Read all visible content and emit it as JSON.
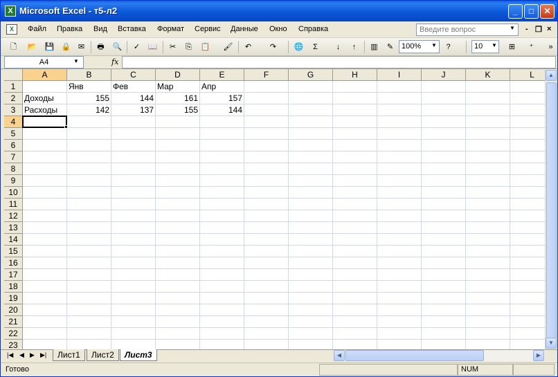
{
  "window": {
    "title": "Microsoft Excel - т5-л2",
    "app_icon": "X",
    "min": "_",
    "max": "□",
    "close": "✕"
  },
  "menu": {
    "doc_icon": "X",
    "items": [
      "Файл",
      "Правка",
      "Вид",
      "Вставка",
      "Формат",
      "Сервис",
      "Данные",
      "Окно",
      "Справка"
    ],
    "help_placeholder": "Введите вопрос",
    "mdi_min": "-",
    "mdi_restore": "❐",
    "mdi_close": "×"
  },
  "toolbar": {
    "zoom": "100%",
    "font_size": "10"
  },
  "formula": {
    "name_box": "A4",
    "fx": "fx",
    "value": ""
  },
  "grid": {
    "columns": [
      "A",
      "B",
      "C",
      "D",
      "E",
      "F",
      "G",
      "H",
      "I",
      "J",
      "K",
      "L"
    ],
    "rows": [
      "1",
      "2",
      "3",
      "4",
      "5",
      "6",
      "7",
      "8",
      "9",
      "10",
      "11",
      "12",
      "13",
      "14",
      "15",
      "16",
      "17",
      "18",
      "19",
      "20",
      "21",
      "22",
      "23"
    ],
    "cells": {
      "B1": "Янв",
      "C1": "Фев",
      "D1": "Мар",
      "E1": "Апр",
      "A2": "Доходы",
      "B2": "155",
      "C2": "144",
      "D2": "161",
      "E2": "157",
      "A3": "Расходы",
      "B3": "142",
      "C3": "137",
      "D3": "155",
      "E3": "144"
    },
    "active_cell": "A4"
  },
  "sheets": {
    "tabs": [
      "Лист1",
      "Лист2",
      "Лист3"
    ],
    "active": "Лист3"
  },
  "status": {
    "text": "Готово",
    "num": "NUM"
  }
}
